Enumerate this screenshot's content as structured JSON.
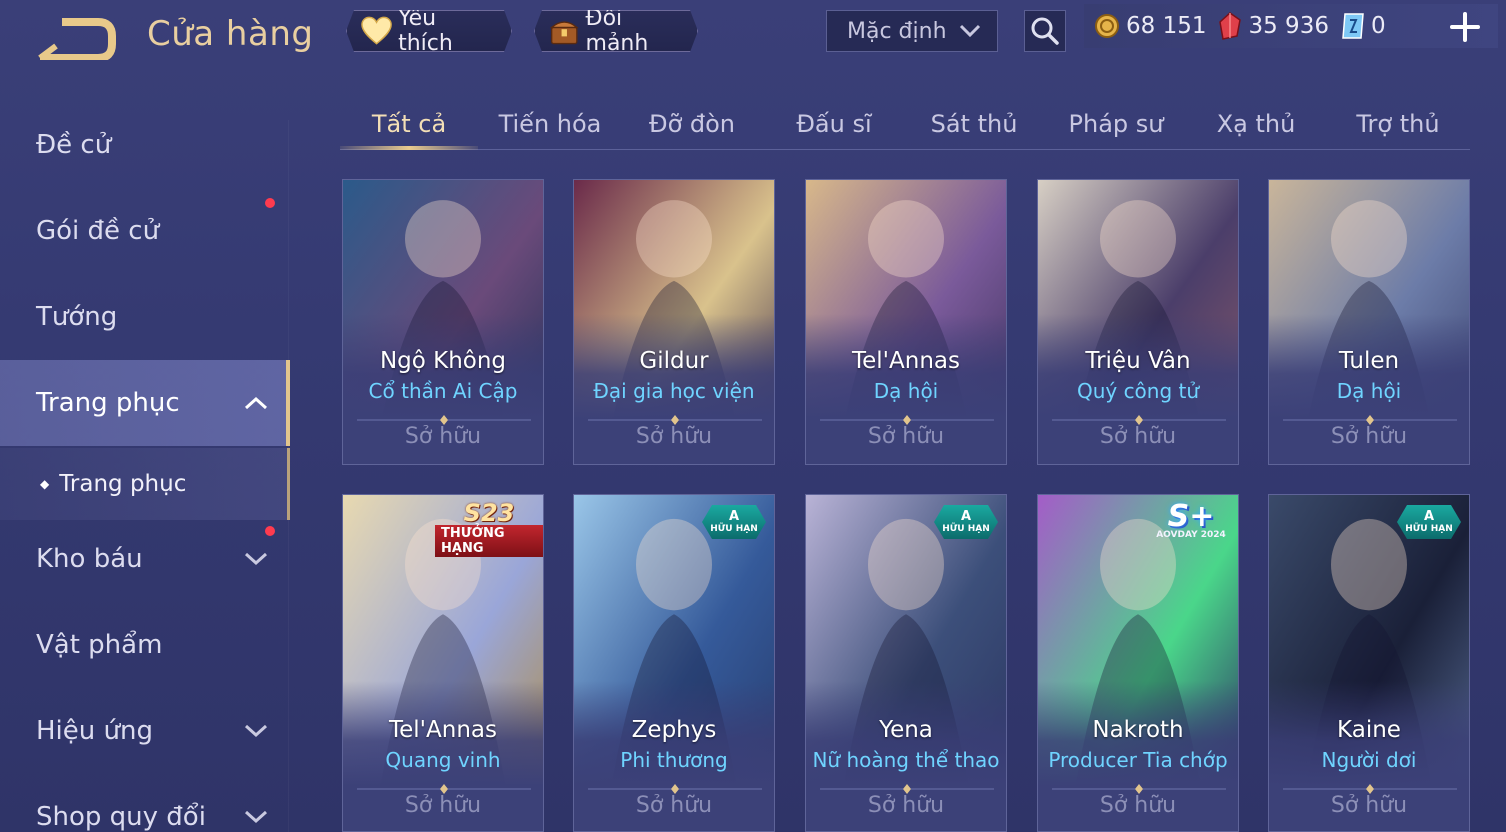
{
  "header": {
    "title": "Cửa hàng",
    "favorite_label": "Yêu thích",
    "exchange_label": "Đổi mảnh",
    "sort_value": "Mặc định",
    "gold": "68 151",
    "vouchers": "35 936",
    "diamonds": "0"
  },
  "sidebar": {
    "items": [
      {
        "label": "Đề cử"
      },
      {
        "label": "Gói đề cử"
      },
      {
        "label": "Tướng"
      },
      {
        "label": "Trang phục"
      },
      {
        "label": "Kho báu"
      },
      {
        "label": "Vật phẩm"
      },
      {
        "label": "Hiệu ứng"
      },
      {
        "label": "Shop quy đổi"
      }
    ],
    "sub_item": "Trang phục"
  },
  "tabs": [
    "Tất cả",
    "Tiến hóa",
    "Đỡ đòn",
    "Đấu sĩ",
    "Sát thủ",
    "Pháp sư",
    "Xạ thủ",
    "Trợ thủ"
  ],
  "cards": [
    {
      "hero": "Ngộ Không",
      "skin": "Cổ thần Ai Cập",
      "status": "Sở hữu"
    },
    {
      "hero": "Gildur",
      "skin": "Đại gia học viện",
      "status": "Sở hữu"
    },
    {
      "hero": "Tel'Annas",
      "skin": "Dạ hội",
      "status": "Sở hữu"
    },
    {
      "hero": "Triệu Vân",
      "skin": "Quý công tử",
      "status": "Sở hữu"
    },
    {
      "hero": "Tulen",
      "skin": "Dạ hội",
      "status": "Sở hữu"
    },
    {
      "hero": "Tel'Annas",
      "skin": "Quang vinh",
      "status": "Sở hữu",
      "badge_main": "S23",
      "badge_sub": "THƯỞNG HẠNG"
    },
    {
      "hero": "Zephys",
      "skin": "Phi thương",
      "status": "Sở hữu",
      "badge_main": "A",
      "badge_sub": "HỮU HẠN"
    },
    {
      "hero": "Yena",
      "skin": "Nữ hoàng thể thao",
      "status": "Sở hữu",
      "badge_main": "A",
      "badge_sub": "HỮU HẠN"
    },
    {
      "hero": "Nakroth",
      "skin": "Producer Tia chớp",
      "status": "Sở hữu",
      "badge_main": "S+",
      "badge_sub": "AOVDAY 2024"
    },
    {
      "hero": "Kaine",
      "skin": "Người dơi",
      "status": "Sở hữu",
      "badge_main": "A",
      "badge_sub": "HỮU HẠN"
    }
  ],
  "colors": {
    "background": "#353a72",
    "accent_gold": "#e9cb8e",
    "skin_name": "#6fd4ff",
    "owned_text": "#8c8fb7",
    "notification_dot": "#ff3b4f"
  }
}
